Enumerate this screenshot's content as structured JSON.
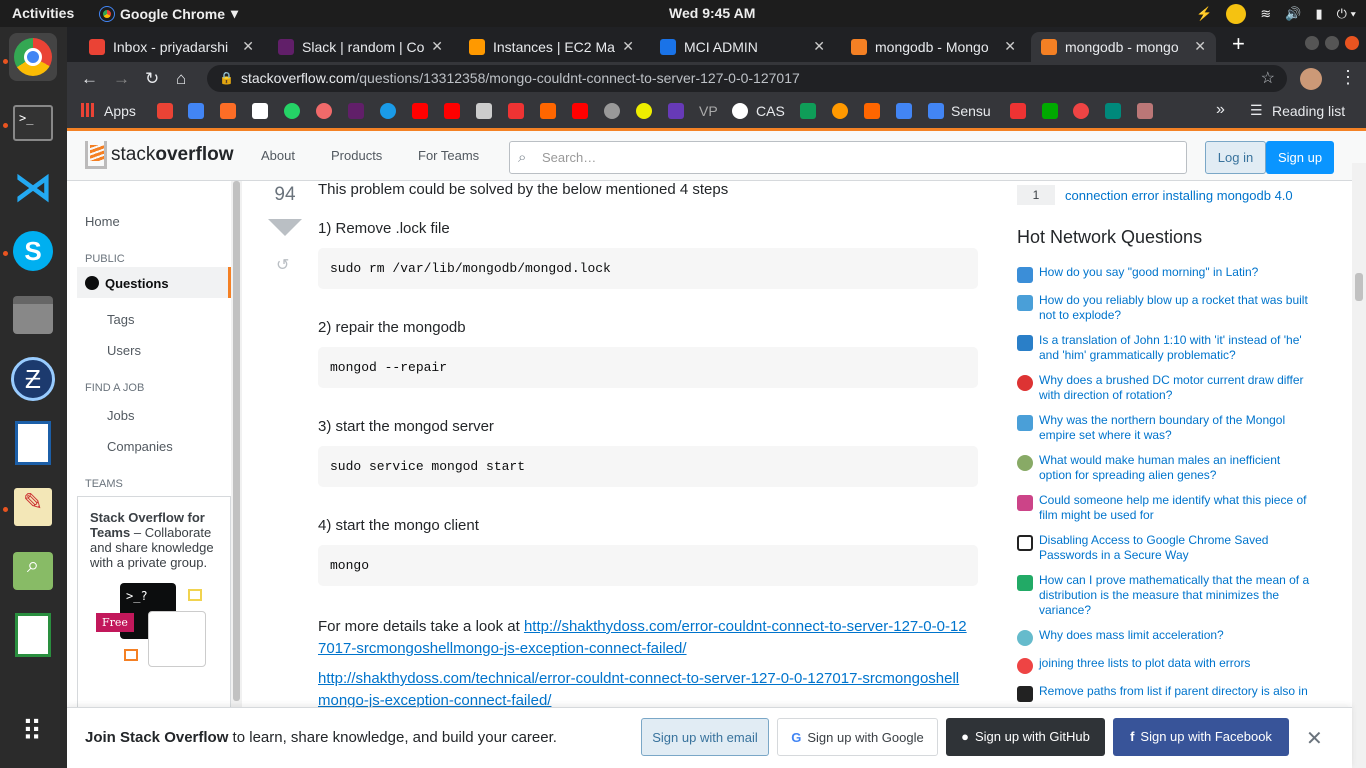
{
  "system": {
    "activities": "Activities",
    "app_name": "Google Chrome",
    "clock": "Wed  9:45 AM"
  },
  "tabs": [
    {
      "label": "Inbox - priyadarshi",
      "color": "#ea4335"
    },
    {
      "label": "Slack | random | Co",
      "color": "#611f69"
    },
    {
      "label": "Instances | EC2 Ma",
      "color": "#f90"
    },
    {
      "label": "MCI ADMIN",
      "color": "#1a73e8"
    },
    {
      "label": "mongodb - Mongo",
      "color": "#f48024"
    },
    {
      "label": "mongodb - mongo",
      "color": "#f48024"
    }
  ],
  "omnibox": {
    "domain": "stackoverflow.com",
    "path": "/questions/13312358/mongo-couldnt-connect-to-server-127-0-0-127017"
  },
  "bookmarks": {
    "apps": "Apps",
    "vp": "VP",
    "cas": "CAS",
    "sensu": "Sensu",
    "reading_list": "Reading list"
  },
  "so_header": {
    "logo_a": "stack",
    "logo_b": "overflow",
    "about": "About",
    "products": "Products",
    "for_teams": "For Teams",
    "search_placeholder": "Search…",
    "login": "Log in",
    "signup": "Sign up"
  },
  "leftnav": {
    "home": "Home",
    "public": "PUBLIC",
    "questions": "Questions",
    "tags": "Tags",
    "users": "Users",
    "find_a_job": "FIND A JOB",
    "jobs": "Jobs",
    "companies": "Companies",
    "teams": "TEAMS",
    "teams_title": "Stack Overflow for Teams",
    "teams_body": " – Collaborate and share knowledge with a private group.",
    "free": "Free"
  },
  "answer": {
    "score": "94",
    "intro": "This problem could be solved by the below mentioned 4 steps",
    "step1": "1) Remove .lock file",
    "code1": "sudo rm /var/lib/mongodb/mongod.lock",
    "step2": "2) repair the mongodb",
    "code2": "mongod --repair",
    "step3": "3) start the mongod server",
    "code3": "sudo service mongod start",
    "step4": "4) start the mongo client",
    "code4": "mongo",
    "details_prefix": "For more details take a look at ",
    "link1": "http://shakthydoss.com/error-couldnt-connect-to-server-127-0-0-127017-srcmongoshellmongo-js-exception-connect-failed/",
    "link2": "http://shakthydoss.com/technical/error-couldnt-connect-to-server-127-0-0-127017-srcmongoshellmongo-js-exception-connect-failed/"
  },
  "sidebar": {
    "linked_count": "1",
    "linked_title": "connection error installing mongodb 4.0",
    "hnq_heading": "Hot Network Questions",
    "hnq": [
      {
        "text": "How do you say \"good morning\" in Latin?",
        "color": "#3b8ed8"
      },
      {
        "text": "How do you reliably blow up a rocket that was built not to explode?",
        "color": "#4a9fd8"
      },
      {
        "text": "Is a translation of John 1:10 with 'it' instead of 'he' and 'him' grammatically problematic?",
        "color": "#2a7fc8"
      },
      {
        "text": "Why does a brushed DC motor current draw differ with direction of rotation?",
        "color": "#d33"
      },
      {
        "text": "Why was the northern boundary of the Mongol empire set where it was?",
        "color": "#4a9fd8"
      },
      {
        "text": "What would make human males an inefficient option for spreading alien genes?",
        "color": "#8a6"
      },
      {
        "text": "Could someone help me identify what this piece of film might be used for",
        "color": "#c48"
      },
      {
        "text": "Disabling Access to Google Chrome Saved Passwords in a Secure Way",
        "color": "#222"
      },
      {
        "text": "How can I prove mathematically that the mean of a distribution is the measure that minimizes the variance?",
        "color": "#2a6"
      },
      {
        "text": "Why does mass limit acceleration?",
        "color": "#6bc"
      },
      {
        "text": "joining three lists to plot data with errors",
        "color": "#e44"
      },
      {
        "text": "Remove paths from list if parent directory is also in",
        "color": "#222"
      }
    ]
  },
  "banner": {
    "join_bold": "Join Stack Overflow",
    "join_rest": " to learn, share knowledge, and build your career.",
    "email": "Sign up with email",
    "google": "Sign up with Google",
    "github": "Sign up with GitHub",
    "facebook": "Sign up with Facebook"
  }
}
